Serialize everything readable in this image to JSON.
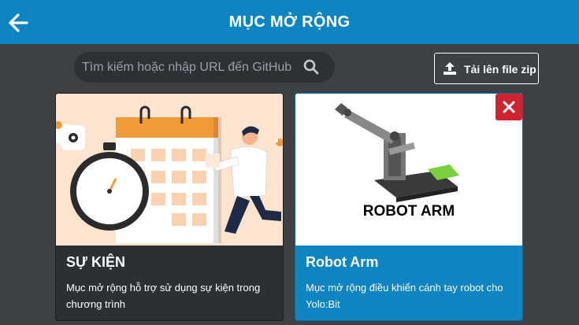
{
  "header": {
    "title": "MỤC MỞ RỘNG",
    "back_icon": "arrow-left-icon"
  },
  "search": {
    "placeholder": "Tìm kiếm hoặc nhập URL đến GitHub",
    "icon": "search-icon"
  },
  "upload": {
    "label": "Tải lên file zip",
    "icon": "upload-icon"
  },
  "extensions": [
    {
      "title": "SỰ KIỆN",
      "description": "Mục mở rộng hỗ trợ sử dụng sự kiện trong chương trình",
      "image": "calendar-stopwatch-illustration"
    },
    {
      "title": "Robot Arm",
      "description": "Mục mở rộng điều khiển cánh tay robot cho Yolo:Bit",
      "image_caption": "ROBOT ARM",
      "image": "robot-arm-illustration",
      "remove_icon": "close-icon"
    }
  ],
  "colors": {
    "header": "#0e84c0",
    "background": "#3c4146",
    "selected_card": "#0e84c0",
    "close": "#d1232f"
  }
}
